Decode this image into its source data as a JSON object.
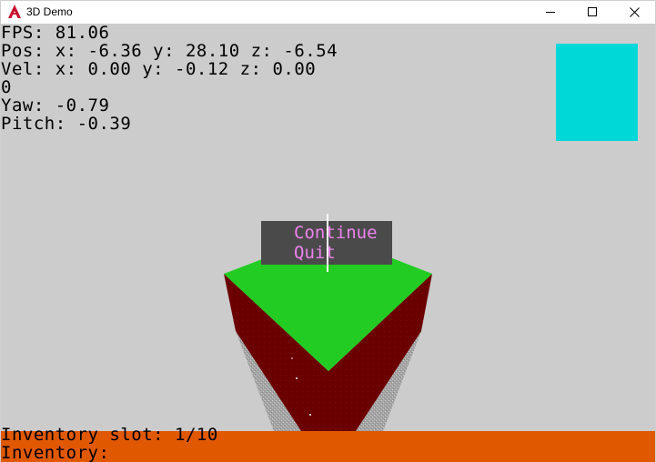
{
  "window": {
    "title": "3D Demo",
    "app_icon": "app-logo-icon",
    "controls": {
      "minimize": "minimize-icon",
      "maximize": "maximize-icon",
      "close": "close-icon"
    }
  },
  "hud": {
    "fps": "FPS: 81.06",
    "pos": "Pos: x: -6.36 y: 28.10 z: -6.54",
    "vel": "Vel: x: 0.00 y: -0.12 z: 0.00",
    "counter": "0",
    "yaw": "Yaw: -0.79",
    "pitch": "Pitch: -0.39"
  },
  "minimap": {
    "color": "#00d8d8"
  },
  "pause_menu": {
    "continue_label": "Continue",
    "quit_label": "Quit",
    "text_color": "#ee82ee",
    "background": "#4a4a4a"
  },
  "inventory": {
    "slot_text": "Inventory slot: 1/10",
    "inventory_label": "Inventory:",
    "bar_color": "#e05800"
  },
  "colors": {
    "sky": "#cccccc",
    "grass_top": "#22cc22",
    "dirt_side": "#6b0000",
    "stone": "#a8a8a8"
  }
}
